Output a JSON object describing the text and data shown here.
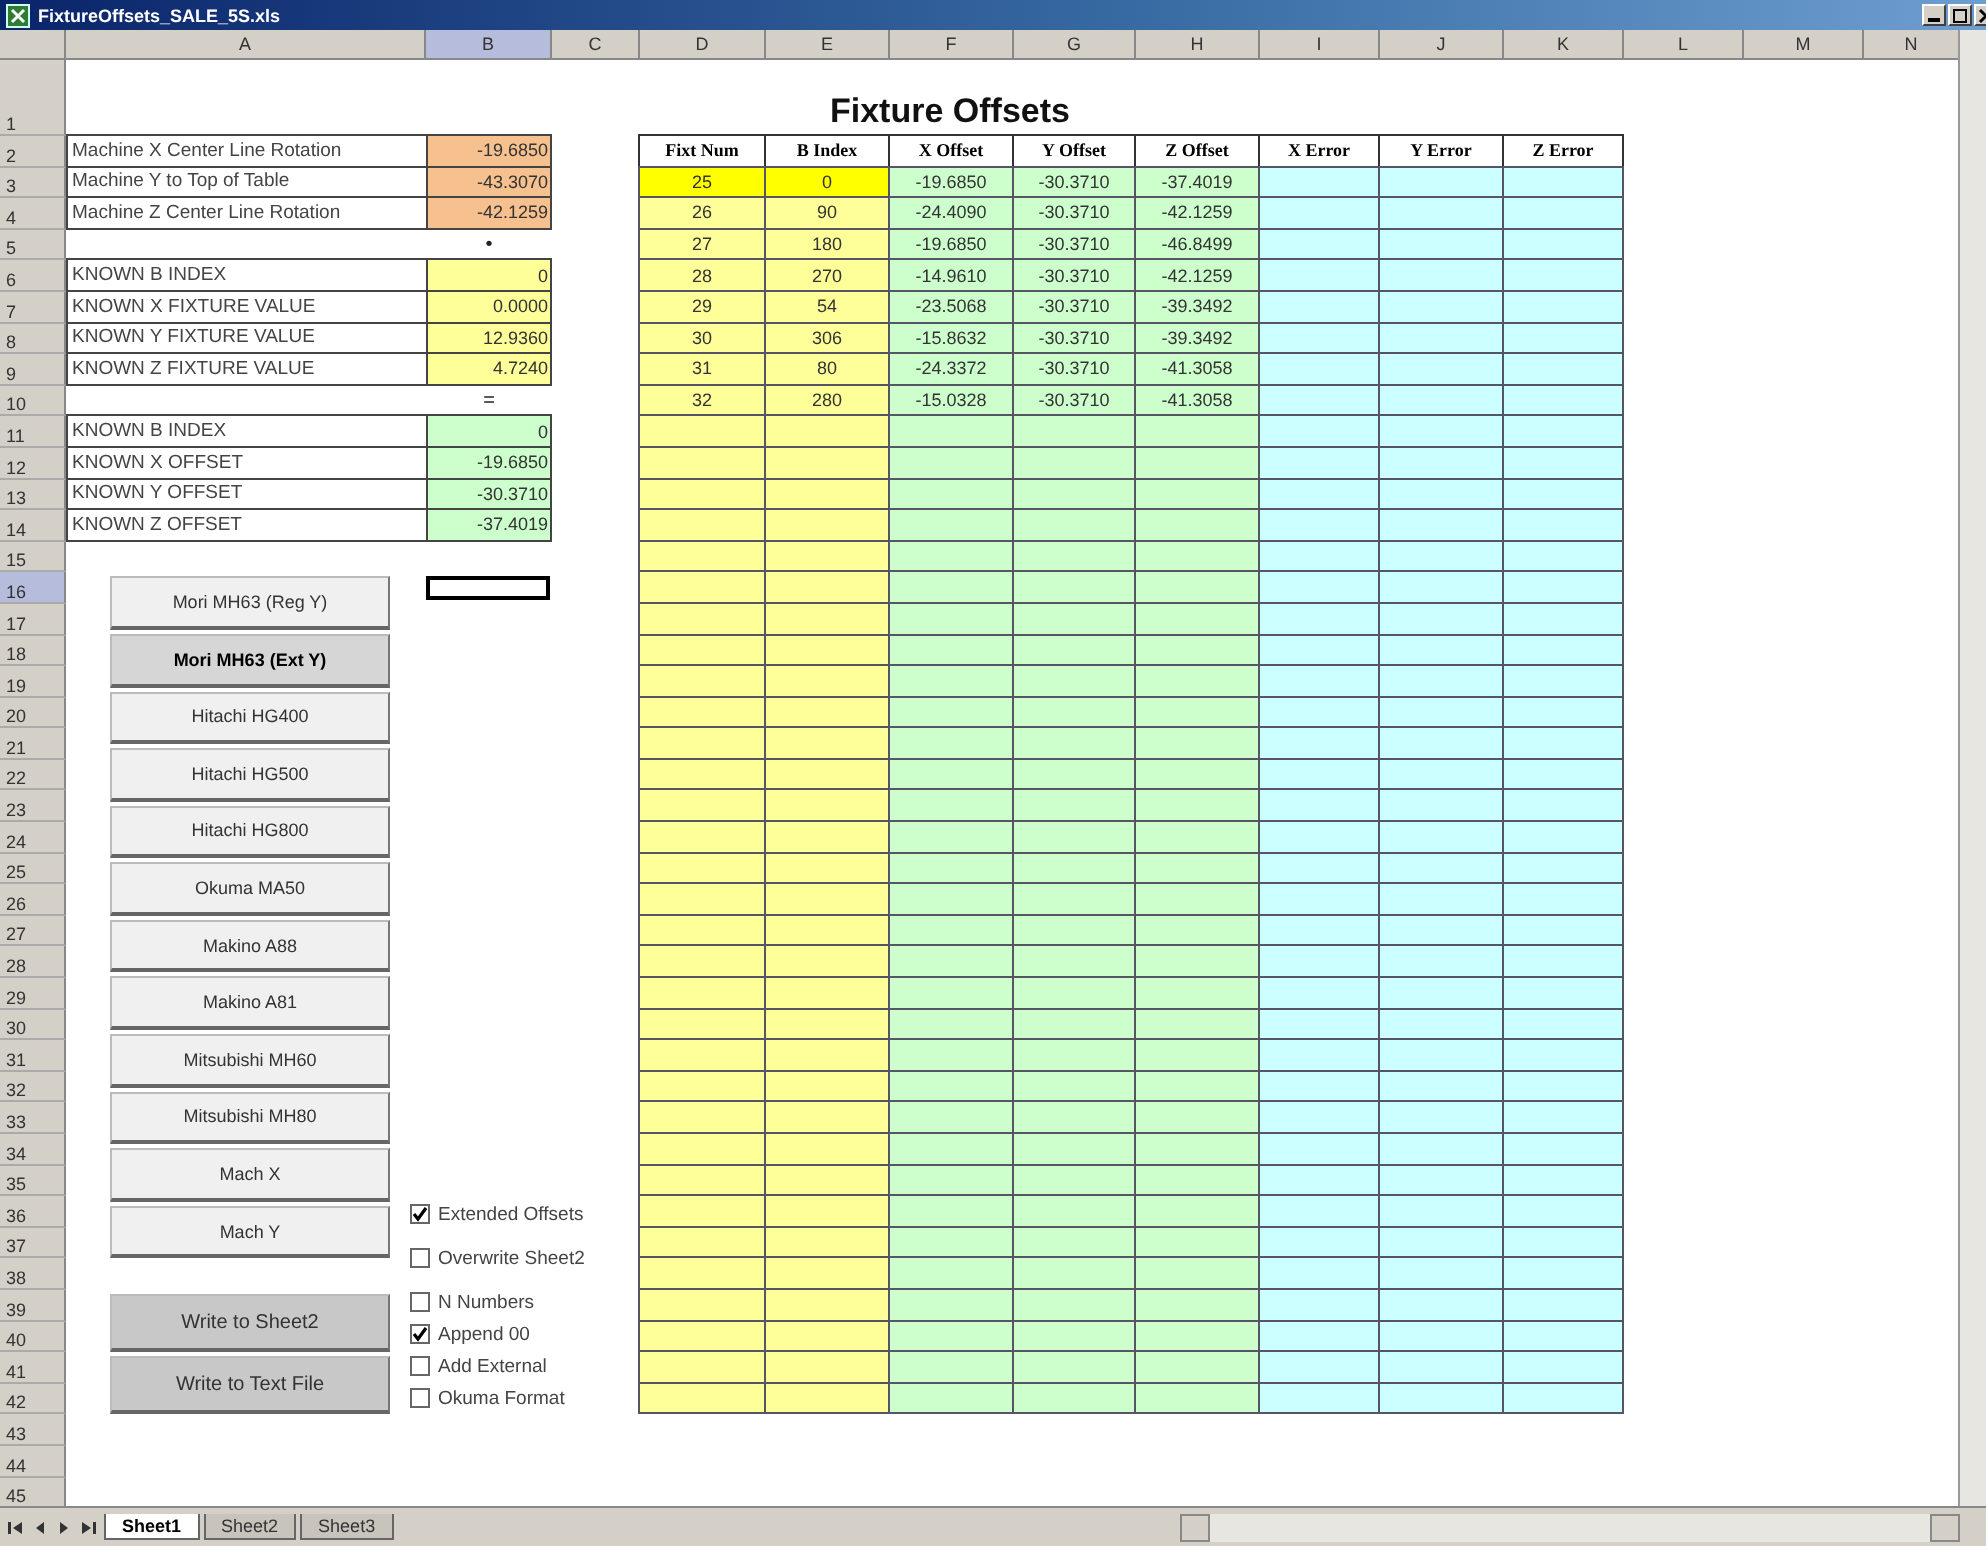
{
  "window": {
    "title": "FixtureOffsets_SALE_5S.xls"
  },
  "column_headers": [
    {
      "label": "A",
      "selected": false
    },
    {
      "label": "B",
      "selected": true
    },
    {
      "label": "C",
      "selected": false
    },
    {
      "label": "D",
      "selected": false
    },
    {
      "label": "E",
      "selected": false
    },
    {
      "label": "F",
      "selected": false
    },
    {
      "label": "G",
      "selected": false
    },
    {
      "label": "H",
      "selected": false
    },
    {
      "label": "I",
      "selected": false
    },
    {
      "label": "J",
      "selected": false
    },
    {
      "label": "K",
      "selected": false
    },
    {
      "label": "L",
      "selected": false
    },
    {
      "label": "M",
      "selected": false
    },
    {
      "label": "N",
      "selected": false
    }
  ],
  "row_headers": [
    {
      "label": "1",
      "selected": false
    },
    {
      "label": "2",
      "selected": false
    },
    {
      "label": "3",
      "selected": false
    },
    {
      "label": "4",
      "selected": false
    },
    {
      "label": "5",
      "selected": false
    },
    {
      "label": "6",
      "selected": false
    },
    {
      "label": "7",
      "selected": false
    },
    {
      "label": "8",
      "selected": false
    },
    {
      "label": "9",
      "selected": false
    },
    {
      "label": "10",
      "selected": false
    },
    {
      "label": "11",
      "selected": false
    },
    {
      "label": "12",
      "selected": false
    },
    {
      "label": "13",
      "selected": false
    },
    {
      "label": "14",
      "selected": false
    },
    {
      "label": "15",
      "selected": false
    },
    {
      "label": "16",
      "selected": true
    },
    {
      "label": "17",
      "selected": false
    },
    {
      "label": "18",
      "selected": false
    },
    {
      "label": "19",
      "selected": false
    },
    {
      "label": "20",
      "selected": false
    },
    {
      "label": "21",
      "selected": false
    },
    {
      "label": "22",
      "selected": false
    },
    {
      "label": "23",
      "selected": false
    },
    {
      "label": "24",
      "selected": false
    },
    {
      "label": "25",
      "selected": false
    },
    {
      "label": "26",
      "selected": false
    },
    {
      "label": "27",
      "selected": false
    },
    {
      "label": "28",
      "selected": false
    },
    {
      "label": "29",
      "selected": false
    },
    {
      "label": "30",
      "selected": false
    },
    {
      "label": "31",
      "selected": false
    },
    {
      "label": "32",
      "selected": false
    },
    {
      "label": "33",
      "selected": false
    },
    {
      "label": "34",
      "selected": false
    },
    {
      "label": "35",
      "selected": false
    },
    {
      "label": "36",
      "selected": false
    },
    {
      "label": "37",
      "selected": false
    },
    {
      "label": "38",
      "selected": false
    },
    {
      "label": "39",
      "selected": false
    },
    {
      "label": "40",
      "selected": false
    },
    {
      "label": "41",
      "selected": false
    },
    {
      "label": "42",
      "selected": false
    },
    {
      "label": "43",
      "selected": false
    },
    {
      "label": "44",
      "selected": false
    },
    {
      "label": "45",
      "selected": false
    }
  ],
  "sheet_title": "Fixture Offsets",
  "parameters": [
    {
      "kind": "machine",
      "label": "Machine X Center Line Rotation",
      "value": "-19.6850"
    },
    {
      "kind": "machine",
      "label": "Machine Y to Top of Table",
      "value": "-43.3070"
    },
    {
      "kind": "machine",
      "label": "Machine Z Center Line Rotation",
      "value": "-42.1259"
    },
    {
      "kind": "separator",
      "value": "•"
    },
    {
      "kind": "known",
      "label": "KNOWN B INDEX",
      "value": "0"
    },
    {
      "kind": "known",
      "label": "KNOWN X FIXTURE VALUE",
      "value": "0.0000"
    },
    {
      "kind": "known",
      "label": "KNOWN Y FIXTURE VALUE",
      "value": "12.9360"
    },
    {
      "kind": "known",
      "label": "KNOWN Z FIXTURE VALUE",
      "value": "4.7240"
    },
    {
      "kind": "separator",
      "value": "="
    },
    {
      "kind": "result",
      "label": "KNOWN B INDEX",
      "value": "0"
    },
    {
      "kind": "result",
      "label": "KNOWN X OFFSET",
      "value": "-19.6850"
    },
    {
      "kind": "result",
      "label": "KNOWN Y OFFSET",
      "value": "-30.3710"
    },
    {
      "kind": "result",
      "label": "KNOWN Z OFFSET",
      "value": "-37.4019"
    }
  ],
  "offsets_table": {
    "columns": [
      {
        "label": "Fixt Num",
        "kind": "input"
      },
      {
        "label": "B Index",
        "kind": "input"
      },
      {
        "label": "X Offset",
        "kind": "offset"
      },
      {
        "label": "Y Offset",
        "kind": "offset"
      },
      {
        "label": "Z Offset",
        "kind": "offset"
      },
      {
        "label": "X Error",
        "kind": "error"
      },
      {
        "label": "Y Error",
        "kind": "error"
      },
      {
        "label": "Z Error",
        "kind": "error"
      }
    ],
    "rows": [
      {
        "highlighted": true,
        "cells": [
          "25",
          "0",
          "-19.6850",
          "-30.3710",
          "-37.4019"
        ]
      },
      {
        "highlighted": false,
        "cells": [
          "26",
          "90",
          "-24.4090",
          "-30.3710",
          "-42.1259"
        ]
      },
      {
        "highlighted": false,
        "cells": [
          "27",
          "180",
          "-19.6850",
          "-30.3710",
          "-46.8499"
        ]
      },
      {
        "highlighted": false,
        "cells": [
          "28",
          "270",
          "-14.9610",
          "-30.3710",
          "-42.1259"
        ]
      },
      {
        "highlighted": false,
        "cells": [
          "29",
          "54",
          "-23.5068",
          "-30.3710",
          "-39.3492"
        ]
      },
      {
        "highlighted": false,
        "cells": [
          "30",
          "306",
          "-15.8632",
          "-30.3710",
          "-39.3492"
        ]
      },
      {
        "highlighted": false,
        "cells": [
          "31",
          "80",
          "-24.3372",
          "-30.3710",
          "-41.3058"
        ]
      },
      {
        "highlighted": false,
        "cells": [
          "32",
          "280",
          "-15.0328",
          "-30.3710",
          "-41.3058"
        ]
      }
    ]
  },
  "machine_buttons": [
    {
      "label": "Mori MH63 (Reg Y)",
      "selected": false
    },
    {
      "label": "Mori MH63 (Ext Y)",
      "selected": true
    },
    {
      "label": "Hitachi HG400",
      "selected": false
    },
    {
      "label": "Hitachi HG500",
      "selected": false
    },
    {
      "label": "Hitachi HG800",
      "selected": false
    },
    {
      "label": "Okuma MA50",
      "selected": false
    },
    {
      "label": "Makino A88",
      "selected": false
    },
    {
      "label": "Makino A81",
      "selected": false
    },
    {
      "label": "Mitsubishi MH60",
      "selected": false
    },
    {
      "label": "Mitsubishi MH80",
      "selected": false
    },
    {
      "label": "Mach X",
      "selected": false
    },
    {
      "label": "Mach Y",
      "selected": false
    }
  ],
  "export_buttons": [
    "Write to Sheet2",
    "Write to Text File"
  ],
  "options": [
    {
      "label": "Extended Offsets",
      "checked": true
    },
    {
      "label": "Overwrite Sheet2",
      "checked": false
    },
    {
      "label": "N Numbers",
      "checked": false
    },
    {
      "label": "Append 00",
      "checked": true
    },
    {
      "label": "Add External",
      "checked": false
    },
    {
      "label": "Okuma Format",
      "checked": false
    }
  ],
  "sheet_tabs": [
    {
      "label": "Sheet1",
      "selected": true
    },
    {
      "label": "Sheet2",
      "selected": false
    },
    {
      "label": "Sheet3",
      "selected": false
    }
  ]
}
